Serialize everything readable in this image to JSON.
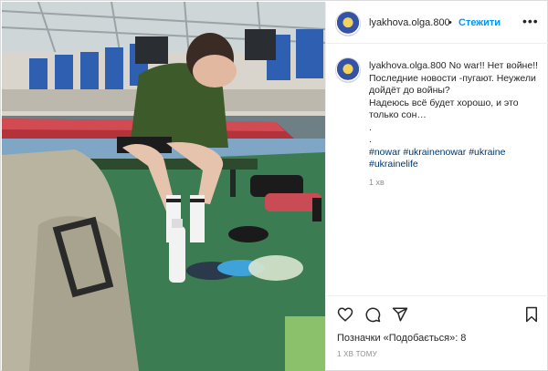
{
  "post": {
    "author": "lyakhova.olga.800",
    "follow_label": "Стежити",
    "separator": "•",
    "more_icon": "more-horizontal-icon",
    "caption_lines": [
      "No war!! Нет войне!!",
      "Последние новости -пугают. Неужели дойдёт до войны?",
      "Надеюсь всё будет хорошо, и это только сон…",
      ".",
      "."
    ],
    "hashtags": [
      "#nowar",
      "#ukrainenowar",
      "#ukraine",
      "#ukrainelife"
    ],
    "caption_time": "1 хв",
    "likes_text": "Позначки «Подобається»: 8",
    "post_time": "1 ХВ ТОМУ"
  },
  "icons": {
    "like": "heart-icon",
    "comment": "comment-icon",
    "share": "send-icon",
    "save": "bookmark-icon"
  },
  "colors": {
    "link": "#0095f6",
    "hashtag": "#00376b",
    "muted": "#8e8e8e",
    "text": "#262626",
    "border": "#dbdbdb"
  }
}
